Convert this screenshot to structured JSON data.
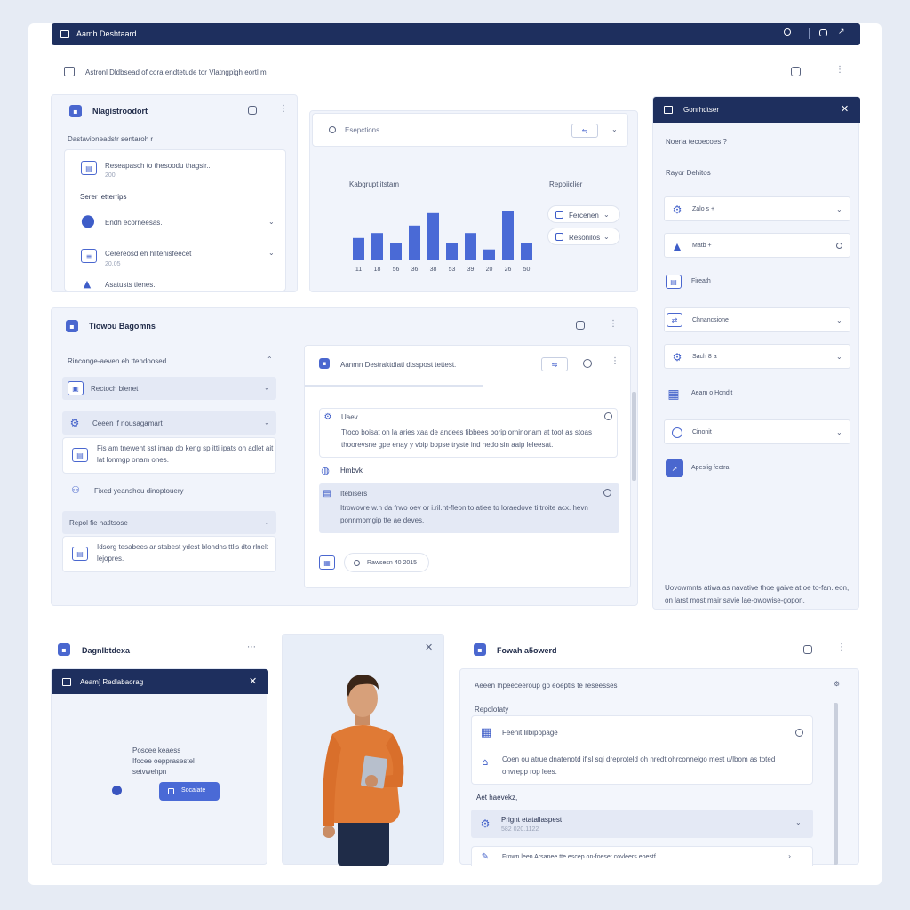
{
  "header": {
    "title": "Aamh Deshtaard",
    "icons": [
      "search-icon",
      "bell-icon",
      "chevron-icon"
    ]
  },
  "breadcrumb": {
    "text": "Astronl Dldbsead of cora endtetude tor Vlatngpigh eortl m"
  },
  "panel_mgmt": {
    "title": "Nlagistroodort",
    "subtitle": "Dastavioneadstr sentaroh r",
    "card_title": "Reseapasch to thesoodu thagsir..",
    "card_value": "200",
    "section_label": "Serer letterrips",
    "items": [
      {
        "label": "Endh ecorneesas."
      },
      {
        "label": "Cerereosd eh hlitenisfeecet",
        "sub": "20.05"
      },
      {
        "label": "Asatusts tienes."
      }
    ]
  },
  "chart_panel": {
    "search_label": "Esepctions",
    "chart_title": "Kabgrupt itstam",
    "legend_title": "Repoiiclier",
    "legend": [
      {
        "label": "Fercenen"
      },
      {
        "label": "Resonilos"
      }
    ]
  },
  "chart_data": {
    "type": "bar",
    "title": "Kabgrupt itstam",
    "categories": [
      "11",
      "18",
      "56",
      "36",
      "38",
      "53",
      "39",
      "20",
      "26",
      "50"
    ],
    "values": [
      45,
      55,
      35,
      70,
      95,
      35,
      55,
      22,
      100,
      35
    ],
    "legend": [
      "Fercenen",
      "Resonilos"
    ],
    "grid": false
  },
  "right_panel": {
    "title": "Gonrhdtser",
    "line1": "Noeria tecoecoes ?",
    "line2": "Rayor Dehitos",
    "items": [
      {
        "label": "Zalo s +"
      },
      {
        "label": "Matb +"
      },
      {
        "label": "Fireath"
      },
      {
        "label": "Chnancsione"
      },
      {
        "label": "Sach 8 a"
      },
      {
        "label": "Aeam o Hondit"
      },
      {
        "label": "Cinonit"
      },
      {
        "label": "Apeslig fectra"
      }
    ],
    "footer": "Uovowmnts atiwa as navative thoe gaive at oe to-fan. eon, on larst most mair savie lae-owowise-gopon."
  },
  "panel_topics": {
    "title": "Tiowou Bagomns",
    "subtitle": "Rinconge-aeven eh ttendoosed",
    "rows": [
      {
        "label": "Rectoch blenet"
      },
      {
        "label": "Ceeen lf nousagamart"
      }
    ],
    "card1_text": "Fis am tnewent sst imap do keng sp itti ipats on adlet ait lat lonmgp onam ones.",
    "item_label": "Fixed yeanshou dinoptouery",
    "row3_label": "Repol fie hatltsose",
    "card2_text": "Idsorg tesabees ar stabest ydest blondns ttlis dto rlnelt lejopres."
  },
  "detail_card": {
    "title": "Aanmn Destraktdiati dtsspost tettest.",
    "m1_title": "Uaev",
    "m1_text": "Ttoco boisat on la aries xaa de andees fibbees borip orhinonam at toot as stoas thoorevsne gpe enay y vbip bopse tryste ind nedo sin aaip leleesat.",
    "section": "Hmbvk",
    "m2_title": "Itebisers",
    "m2_text": "Itrowovre w.n da frwo oev or i.ril.nt-fleon to atiee to loraedove ti troite acx. hevn ponnmomgip tte ae deves.",
    "search_label": "Rawsesn 40 2015"
  },
  "bottom_left": {
    "header": "Dagnlbtdexa",
    "modal_title": "Aeam] Redlabaorag",
    "text_lines": [
      "Poscee keaess",
      "Ifocee oepprasestel",
      "setvwehpn"
    ],
    "button": "Socalate"
  },
  "bottom_right": {
    "title": "Fowah a5owerd",
    "subtitle": "Aeeen lhpeeceeroup gp eoeptls te reseesses",
    "section": "Repolotaty",
    "card_title": "Feenit lilbipopage",
    "card_text": "Coen ou atrue dnatenotd ifisl sqi dreproteld oh nredt ohrconneigo mest u/lbom as toted onvrepp rop lees.",
    "label2": "Aet haevekz,",
    "row_title": "Prignt etatallaspest",
    "row_sub": "582 020.1122",
    "row3": "Frown leen Arsanee tte escep on-foeset covleers eoestf"
  },
  "colors": {
    "navy": "#1e2f5e",
    "accent": "#4a6ad6",
    "background": "#e6ebf4",
    "shirt": "#e07a35"
  }
}
